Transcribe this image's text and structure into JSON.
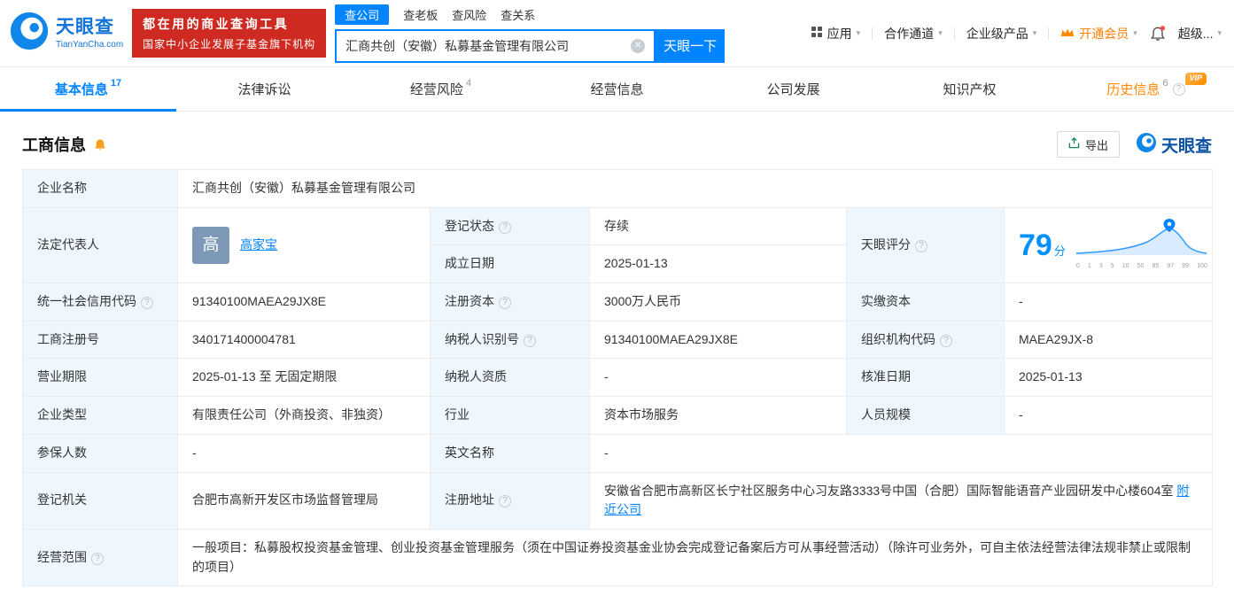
{
  "icons": {
    "caret": "▾",
    "clear": "✕",
    "help": "?"
  },
  "header": {
    "brand": {
      "name": "天眼查",
      "domain": "TianYanCha.com"
    },
    "promo": {
      "line1": "都在用的商业查询工具",
      "line2": "国家中小企业发展子基金旗下机构"
    },
    "search": {
      "tabs": [
        {
          "label": "查公司"
        },
        {
          "label": "查老板"
        },
        {
          "label": "查风险"
        },
        {
          "label": "查关系"
        }
      ],
      "value": "汇商共创（安徽）私募基金管理有限公司",
      "button": "天眼一下"
    },
    "nav": {
      "apps": "应用",
      "channel": "合作通道",
      "enterprise": "企业级产品",
      "member": "开通会员",
      "super": "超级..."
    }
  },
  "tabs": [
    {
      "label": "基本信息",
      "count": "17"
    },
    {
      "label": "法律诉讼"
    },
    {
      "label": "经营风险",
      "count": "4"
    },
    {
      "label": "经营信息"
    },
    {
      "label": "公司发展"
    },
    {
      "label": "知识产权"
    },
    {
      "label": "历史信息",
      "count": "6",
      "vip": "VIP"
    }
  ],
  "section": {
    "title": "工商信息",
    "export": "导出",
    "brand": "天眼查"
  },
  "table": {
    "name_label": "企业名称",
    "name": "汇商共创（安徽）私募基金管理有限公司",
    "legal_rep_label": "法定代表人",
    "legal_rep_avatar": "高",
    "legal_rep": "高家宝",
    "reg_status_label": "登记状态",
    "reg_status": "存续",
    "score_label": "天眼评分",
    "est_date_label": "成立日期",
    "est_date": "2025-01-13",
    "credit_code_label": "统一社会信用代码",
    "credit_code": "91340100MAEA29JX8E",
    "reg_capital_label": "注册资本",
    "reg_capital": "3000万人民币",
    "paid_capital_label": "实缴资本",
    "paid_capital": "-",
    "reg_number_label": "工商注册号",
    "reg_number": "340171400004781",
    "taxpayer_id_label": "纳税人识别号",
    "taxpayer_id": "91340100MAEA29JX8E",
    "org_code_label": "组织机构代码",
    "org_code": "MAEA29JX-8",
    "term_label": "营业期限",
    "term": "2025-01-13 至 无固定期限",
    "taxpayer_quality_label": "纳税人资质",
    "taxpayer_quality": "-",
    "approval_date_label": "核准日期",
    "approval_date": "2025-01-13",
    "type_label": "企业类型",
    "type": "有限责任公司（外商投资、非独资）",
    "industry_label": "行业",
    "industry": "资本市场服务",
    "staff_label": "人员规模",
    "staff": "-",
    "insured_label": "参保人数",
    "insured": "-",
    "english_label": "英文名称",
    "english": "-",
    "authority_label": "登记机关",
    "authority": "合肥市高新开发区市场监督管理局",
    "address_label": "注册地址",
    "address": "安徽省合肥市高新区长宁社区服务中心习友路3333号中国（合肥）国际智能语音产业园研发中心楼604室",
    "nearby": "附近公司",
    "scope_label": "经营范围",
    "scope": "一般项目：私募股权投资基金管理、创业投资基金管理服务（须在中国证券投资基金业协会完成登记备案后方可从事经营活动）（除许可业务外，可自主依法经营法律法规非禁止或限制的项目）"
  },
  "score_chart": {
    "score": "79",
    "unit": "分",
    "x_labels": [
      "0",
      "1",
      "3",
      "5",
      "10",
      "50",
      "85",
      "97",
      "99",
      "100"
    ]
  }
}
